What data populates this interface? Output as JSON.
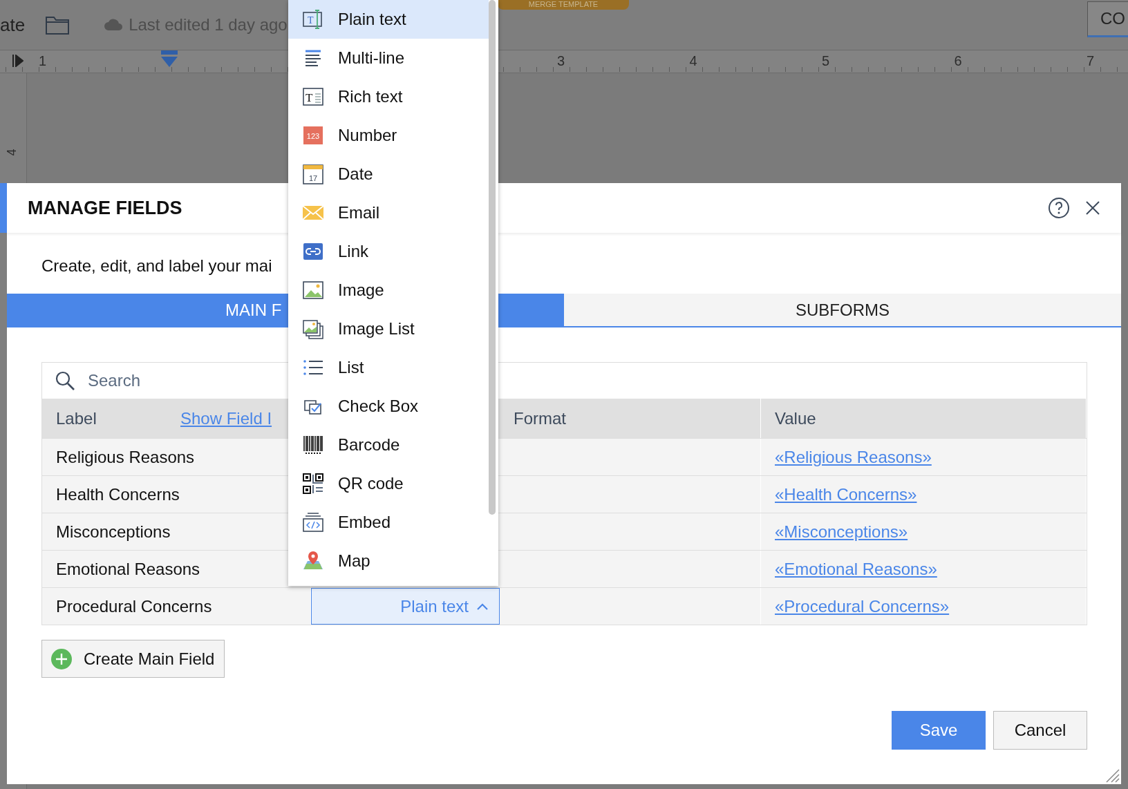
{
  "editor": {
    "title_fragment": "ate",
    "status": "Last edited 1 day ago",
    "badge": "MERGE TEMPLATE",
    "button_fragment": "CO",
    "ruler_numbers": [
      "1",
      "3",
      "4",
      "5",
      "6",
      "7"
    ],
    "vertical_ruler_number": "4"
  },
  "dialog": {
    "title": "MANAGE FIELDS",
    "description": "Create, edit, and label your mai",
    "tabs": [
      {
        "label": "MAIN F",
        "selected": true
      },
      {
        "label": "SUBFORMS",
        "selected": false
      }
    ],
    "search": {
      "placeholder": "Search"
    },
    "columns": [
      "Label",
      "Format",
      "Value"
    ],
    "show_ids_link": "Show Field I",
    "rows": [
      {
        "label": "Religious Reasons",
        "value": "«Religious Reasons»"
      },
      {
        "label": "Health Concerns",
        "value": "«Health Concerns»"
      },
      {
        "label": "Misconceptions",
        "value": "«Misconceptions»"
      },
      {
        "label": "Emotional Reasons",
        "value": "«Emotional Reasons»"
      },
      {
        "label": "Procedural Concerns",
        "value": "«Procedural Concerns»"
      }
    ],
    "format_dropdown": {
      "value": "Plain text",
      "expanded": true
    },
    "create_button": "Create Main Field",
    "buttons": [
      {
        "label": "Save",
        "kind": "primary"
      },
      {
        "label": "Cancel",
        "kind": "secondary"
      }
    ]
  },
  "menu": {
    "items": [
      {
        "label": "Plain text",
        "kind": "plain",
        "selected": true,
        "icon_text": "T"
      },
      {
        "label": "Multi-line",
        "kind": "multiline",
        "selected": false
      },
      {
        "label": "Rich text",
        "kind": "rich",
        "selected": false,
        "icon_text": "T"
      },
      {
        "label": "Number",
        "kind": "number",
        "selected": false,
        "icon_text": "123"
      },
      {
        "label": "Date",
        "kind": "date",
        "selected": false,
        "icon_text": "17"
      },
      {
        "label": "Email",
        "kind": "email",
        "selected": false
      },
      {
        "label": "Link",
        "kind": "link",
        "selected": false
      },
      {
        "label": "Image",
        "kind": "image",
        "selected": false
      },
      {
        "label": "Image List",
        "kind": "imagelist",
        "selected": false
      },
      {
        "label": "List",
        "kind": "list",
        "selected": false
      },
      {
        "label": "Check Box",
        "kind": "checkbox",
        "selected": false
      },
      {
        "label": "Barcode",
        "kind": "barcode",
        "selected": false
      },
      {
        "label": "QR code",
        "kind": "qr",
        "selected": false
      },
      {
        "label": "Embed",
        "kind": "embed",
        "selected": false
      },
      {
        "label": "Map",
        "kind": "map",
        "selected": false
      }
    ]
  }
}
